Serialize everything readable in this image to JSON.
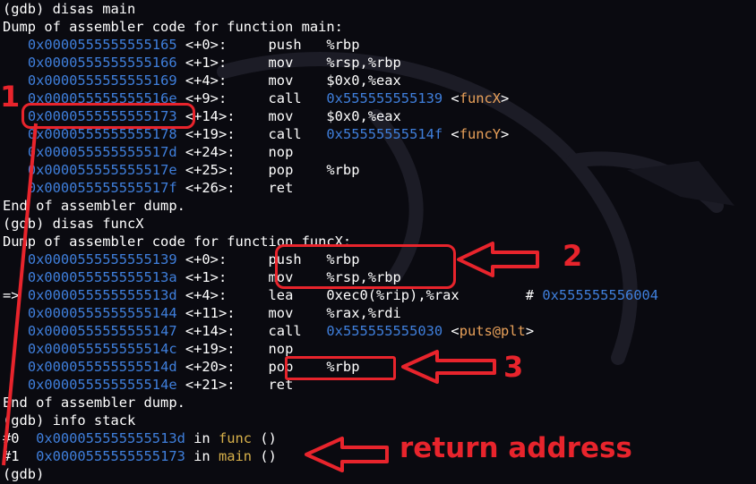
{
  "lines": [
    {
      "parts": [
        {
          "t": "(gdb) disas main",
          "c": "white"
        }
      ]
    },
    {
      "parts": [
        {
          "t": "Dump of assembler code for function main:",
          "c": "white"
        }
      ]
    },
    {
      "parts": [
        {
          "t": "   ",
          "c": "white"
        },
        {
          "t": "0x0000555555555165",
          "c": "blue"
        },
        {
          "t": " <+0>:     push   %rbp",
          "c": "white"
        }
      ]
    },
    {
      "parts": [
        {
          "t": "   ",
          "c": "white"
        },
        {
          "t": "0x0000555555555166",
          "c": "blue"
        },
        {
          "t": " <+1>:     mov    %rsp,%rbp",
          "c": "white"
        }
      ]
    },
    {
      "parts": [
        {
          "t": "   ",
          "c": "white"
        },
        {
          "t": "0x0000555555555169",
          "c": "blue"
        },
        {
          "t": " <+4>:     mov    $0x0,%eax",
          "c": "white"
        }
      ]
    },
    {
      "parts": [
        {
          "t": "   ",
          "c": "white"
        },
        {
          "t": "0x000055555555516e",
          "c": "blue"
        },
        {
          "t": " <+9>:     call   ",
          "c": "white"
        },
        {
          "t": "0x555555555139",
          "c": "blue"
        },
        {
          "t": " <",
          "c": "white"
        },
        {
          "t": "funcX",
          "c": "orange"
        },
        {
          "t": ">",
          "c": "white"
        }
      ]
    },
    {
      "parts": [
        {
          "t": "   ",
          "c": "white"
        },
        {
          "t": "0x0000555555555173",
          "c": "blue"
        },
        {
          "t": " <+14>:    mov    $0x0,%eax",
          "c": "white"
        }
      ]
    },
    {
      "parts": [
        {
          "t": "   ",
          "c": "white"
        },
        {
          "t": "0x0000555555555178",
          "c": "blue"
        },
        {
          "t": " <+19>:    call   ",
          "c": "white"
        },
        {
          "t": "0x55555555514f",
          "c": "blue"
        },
        {
          "t": " <",
          "c": "white"
        },
        {
          "t": "funcY",
          "c": "orange"
        },
        {
          "t": ">",
          "c": "white"
        }
      ]
    },
    {
      "parts": [
        {
          "t": "   ",
          "c": "white"
        },
        {
          "t": "0x000055555555517d",
          "c": "blue"
        },
        {
          "t": " <+24>:    nop",
          "c": "white"
        }
      ]
    },
    {
      "parts": [
        {
          "t": "   ",
          "c": "white"
        },
        {
          "t": "0x000055555555517e",
          "c": "blue"
        },
        {
          "t": " <+25>:    pop    %rbp",
          "c": "white"
        }
      ]
    },
    {
      "parts": [
        {
          "t": "   ",
          "c": "white"
        },
        {
          "t": "0x000055555555517f",
          "c": "blue"
        },
        {
          "t": " <+26>:    ret",
          "c": "white"
        }
      ]
    },
    {
      "parts": [
        {
          "t": "End of assembler dump.",
          "c": "white"
        }
      ]
    },
    {
      "parts": [
        {
          "t": "(gdb) disas funcX",
          "c": "white"
        }
      ]
    },
    {
      "parts": [
        {
          "t": "Dump of assembler code for function funcX:",
          "c": "white"
        }
      ]
    },
    {
      "parts": [
        {
          "t": "   ",
          "c": "white"
        },
        {
          "t": "0x0000555555555139",
          "c": "blue"
        },
        {
          "t": " <+0>:     push   %rbp",
          "c": "white"
        }
      ]
    },
    {
      "parts": [
        {
          "t": "   ",
          "c": "white"
        },
        {
          "t": "0x000055555555513a",
          "c": "blue"
        },
        {
          "t": " <+1>:     mov    %rsp,%rbp",
          "c": "white"
        }
      ]
    },
    {
      "parts": [
        {
          "t": "=> ",
          "c": "white"
        },
        {
          "t": "0x000055555555513d",
          "c": "blue"
        },
        {
          "t": " <+4>:     lea    0xec0(%rip),%rax        # ",
          "c": "white"
        },
        {
          "t": "0x555555556004",
          "c": "blue"
        }
      ]
    },
    {
      "parts": [
        {
          "t": "   ",
          "c": "white"
        },
        {
          "t": "0x0000555555555144",
          "c": "blue"
        },
        {
          "t": " <+11>:    mov    %rax,%rdi",
          "c": "white"
        }
      ]
    },
    {
      "parts": [
        {
          "t": "   ",
          "c": "white"
        },
        {
          "t": "0x0000555555555147",
          "c": "blue"
        },
        {
          "t": " <+14>:    call   ",
          "c": "white"
        },
        {
          "t": "0x555555555030",
          "c": "blue"
        },
        {
          "t": " <",
          "c": "white"
        },
        {
          "t": "puts@plt",
          "c": "orange"
        },
        {
          "t": ">",
          "c": "white"
        }
      ]
    },
    {
      "parts": [
        {
          "t": "   ",
          "c": "white"
        },
        {
          "t": "0x000055555555514c",
          "c": "blue"
        },
        {
          "t": " <+19>:    nop",
          "c": "white"
        }
      ]
    },
    {
      "parts": [
        {
          "t": "   ",
          "c": "white"
        },
        {
          "t": "0x000055555555514d",
          "c": "blue"
        },
        {
          "t": " <+20>:    pop    %rbp",
          "c": "white"
        }
      ]
    },
    {
      "parts": [
        {
          "t": "   ",
          "c": "white"
        },
        {
          "t": "0x000055555555514e",
          "c": "blue"
        },
        {
          "t": " <+21>:    ret",
          "c": "white"
        }
      ]
    },
    {
      "parts": [
        {
          "t": "End of assembler dump.",
          "c": "white"
        }
      ]
    },
    {
      "parts": [
        {
          "t": "(gdb) info stack",
          "c": "white"
        }
      ]
    },
    {
      "parts": [
        {
          "t": "#0  ",
          "c": "white"
        },
        {
          "t": "0x000055555555513d",
          "c": "blue"
        },
        {
          "t": " in ",
          "c": "white"
        },
        {
          "t": "func",
          "c": "yellow"
        },
        {
          "t": " ()",
          "c": "white"
        }
      ]
    },
    {
      "parts": [
        {
          "t": "#1  ",
          "c": "white"
        },
        {
          "t": "0x0000555555555173",
          "c": "blue"
        },
        {
          "t": " in ",
          "c": "white"
        },
        {
          "t": "main",
          "c": "yellow"
        },
        {
          "t": " ()",
          "c": "white"
        }
      ]
    },
    {
      "parts": [
        {
          "t": "(gdb)",
          "c": "white"
        }
      ]
    }
  ],
  "annotations": {
    "label1": "1",
    "label2": "2",
    "label3": "3",
    "return_label": "return address"
  },
  "colors": {
    "background": "#0a0a10",
    "text": "#ffffff",
    "address": "#3f7fdc",
    "symbol": "#e9a15a",
    "frame_function": "#d7b04a",
    "annotation_red": "#e8242c"
  }
}
